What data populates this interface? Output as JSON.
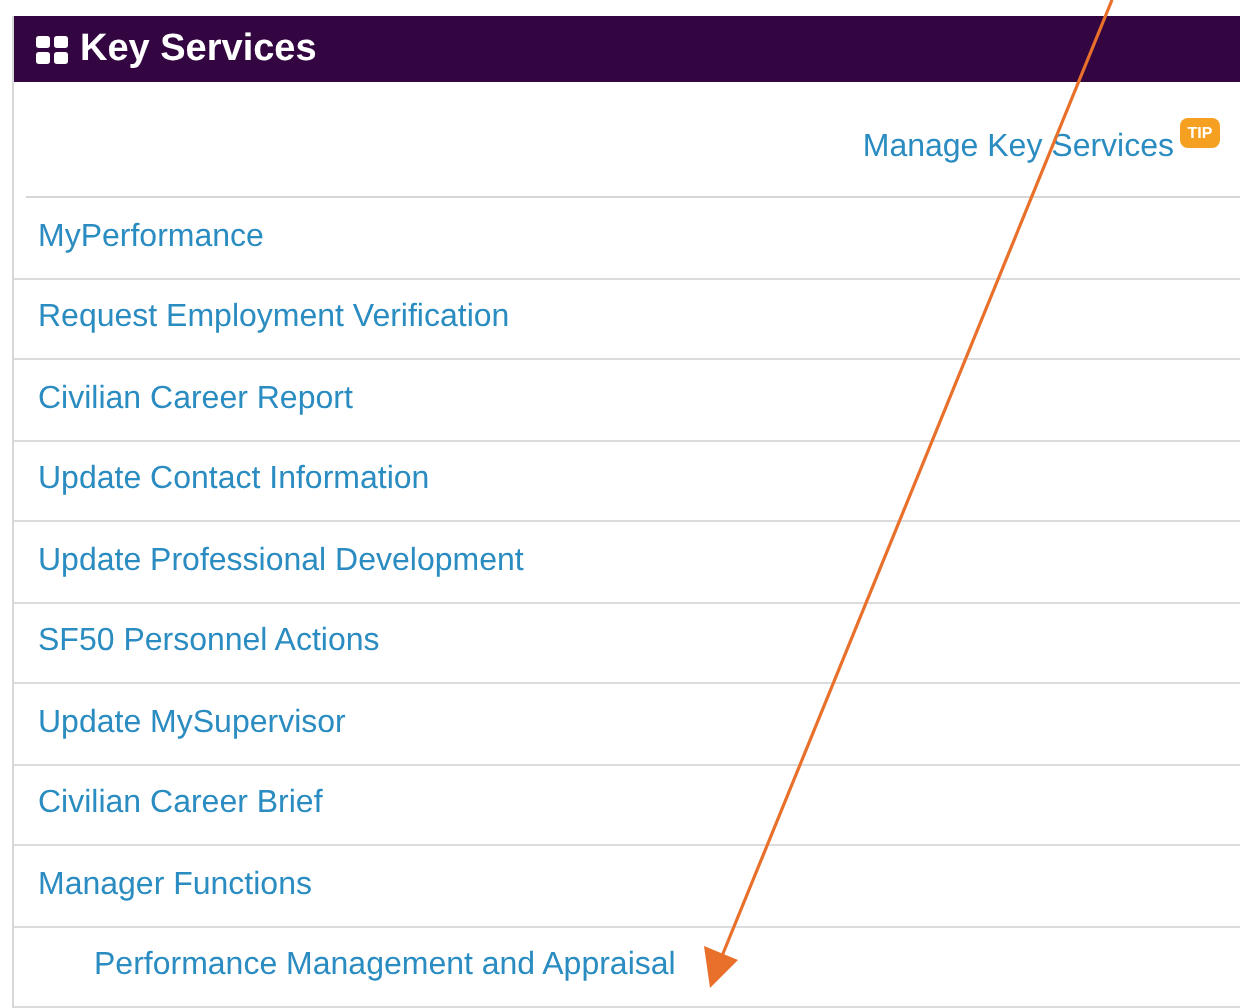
{
  "panel": {
    "title": "Key Services"
  },
  "manage_link": {
    "label": "Manage Key Services",
    "tip_badge": "TIP"
  },
  "services": [
    {
      "label": "MyPerformance"
    },
    {
      "label": "Request Employment Verification"
    },
    {
      "label": "Civilian Career Report"
    },
    {
      "label": "Update Contact Information"
    },
    {
      "label": "Update Professional Development"
    },
    {
      "label": "SF50 Personnel Actions"
    },
    {
      "label": "Update MySupervisor"
    },
    {
      "label": "Civilian Career Brief"
    },
    {
      "label": "Manager Functions",
      "children": [
        {
          "label": "Performance Management and Appraisal"
        }
      ]
    }
  ]
}
